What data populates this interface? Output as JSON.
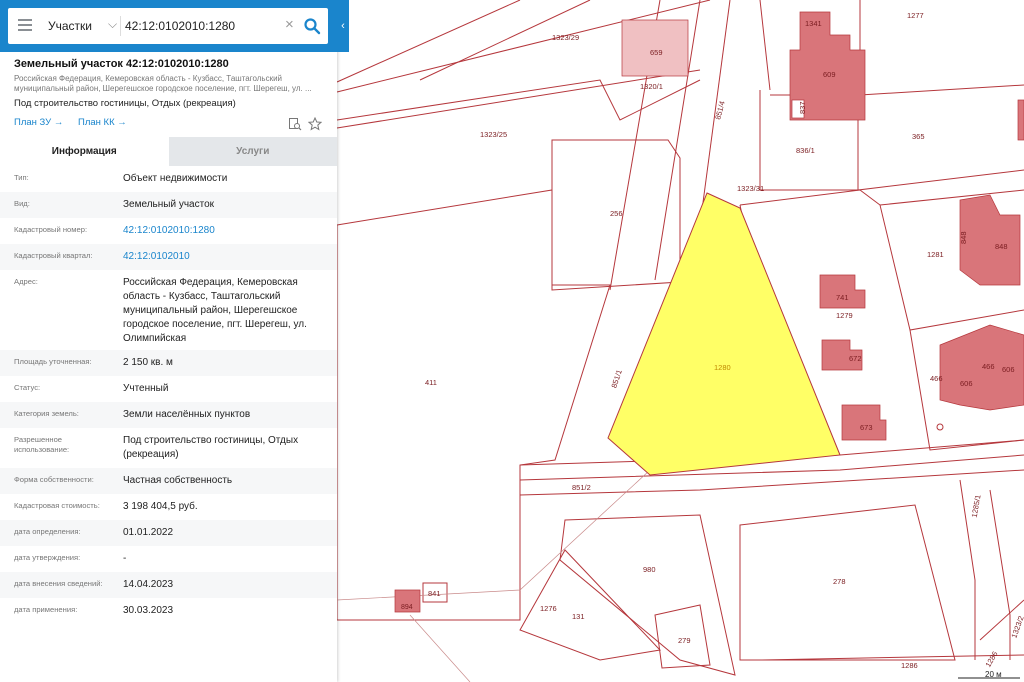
{
  "search": {
    "layer_label": "Участки",
    "query": "42:12:0102010:1280"
  },
  "object": {
    "title": "Земельный участок 42:12:0102010:1280",
    "address_short": "Российская Федерация, Кемеровская область - Кузбасс, Таштагольский муниципальный район, Шерегешское городское поселение, пгт. Шерегеш, ул. ...",
    "use": "Под строительство гостиницы, Отдых (рекреация)",
    "link_zu": "План ЗУ →",
    "link_kk": "План КК →"
  },
  "tabs": [
    {
      "label": "Информация",
      "active": true
    },
    {
      "label": "Услуги",
      "active": false
    }
  ],
  "rows": [
    {
      "key": "Тип:",
      "value": "Объект недвижимости",
      "link": false
    },
    {
      "key": "Вид:",
      "value": "Земельный участок",
      "link": false
    },
    {
      "key": "Кадастровый номер:",
      "value": "42:12:0102010:1280",
      "link": true
    },
    {
      "key": "Кадастровый квартал:",
      "value": "42:12:0102010",
      "link": true
    },
    {
      "key": "Адрес:",
      "value": "Российская Федерация, Кемеровская область - Кузбасс, Таштагольский муниципальный район, Шерегешское городское поселение, пгт. Шерегеш, ул. Олимпийская",
      "link": false
    },
    {
      "key": "Площадь уточненная:",
      "value": "2 150 кв. м",
      "link": false
    },
    {
      "key": "Статус:",
      "value": "Учтенный",
      "link": false
    },
    {
      "key": "Категория земель:",
      "value": "Земли населённых пунктов",
      "link": false
    },
    {
      "key": "Разрешенное использование:",
      "value": "Под строительство гостиницы, Отдых (рекреация)",
      "link": false
    },
    {
      "key": "Форма собственности:",
      "value": "Частная собственность",
      "link": false
    },
    {
      "key": "Кадастровая стоимость:",
      "value": "3 198 404,5 руб.",
      "link": false
    },
    {
      "key": "дата определения:",
      "value": "01.01.2022",
      "link": false
    },
    {
      "key": "дата утверждения:",
      "value": "-",
      "link": false
    },
    {
      "key": "дата внесения сведений:",
      "value": "14.04.2023",
      "link": false
    },
    {
      "key": "дата применения:",
      "value": "30.03.2023",
      "link": false
    }
  ],
  "map": {
    "parcel_color": "#b5373c",
    "building_color": "#d9757a",
    "selected_fill": "#ffff66",
    "labels": {
      "p1323_29": "1323/29",
      "p659": "659",
      "p1320_1": "1320/1",
      "p1323_25": "1323/25",
      "p851_4": "851/4",
      "p1341": "1341",
      "p609": "609",
      "p1277": "1277",
      "p837": "837",
      "p836_1": "836/1",
      "p365": "365",
      "p256": "256",
      "p1323_31": "1323/31",
      "p848": "848",
      "p848b": "848",
      "p1281": "1281",
      "p741": "741",
      "p1279": "1279",
      "p1280": "1280",
      "p672": "672",
      "p466": "466",
      "p466b": "466",
      "p606": "606",
      "p606b": "606",
      "p673": "673",
      "p411": "411",
      "p851_1": "851/1",
      "p851_2": "851/2",
      "p1285_1": "1285/1",
      "p980": "980",
      "p278": "278",
      "p894": "894",
      "p841": "841",
      "p1276": "1276",
      "p131": "131",
      "p279": "279",
      "p1286": "1286",
      "p1323_2": "1323/2",
      "p1286b": "1286"
    },
    "scale": "20 м"
  }
}
